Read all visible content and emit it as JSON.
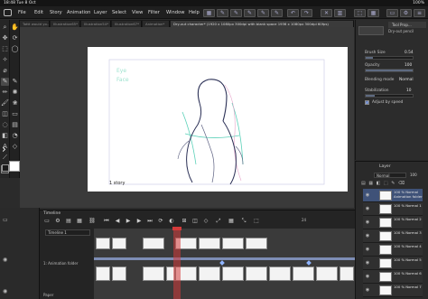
{
  "status_bar": {
    "time": "18:48",
    "date": "Tue 8 Oct",
    "battery": "100%"
  },
  "menubar": {
    "items": [
      "File",
      "Edit",
      "Story",
      "Animation",
      "Layer",
      "Select",
      "View",
      "Filter",
      "Window",
      "Help"
    ]
  },
  "tabs": [
    "Tattt would yo...",
    "Illustration65*",
    "Illustration54*",
    "Illustration67*",
    "Animation*",
    "Dry-out character* (1920 x 1080px 300dpi with blank space 1936 x 1080px 300dpi 60fps)"
  ],
  "properties": {
    "title": "Tool Prop...",
    "brush_name": "Dry-out pencil",
    "brush_size_label": "Brush Size",
    "brush_size_value": "0.54",
    "brush_size_fill": 0.15,
    "opacity_label": "Opacity",
    "opacity_value": "100",
    "opacity_fill": 1.0,
    "blend_label": "Blending mode",
    "blend_value": "Normal",
    "stabilization_label": "Stabilization",
    "stabilization_value": "10",
    "stabilization_fill": 0.2,
    "adjust_speed_label": "Adjust by speed",
    "adjust_speed_checked": true
  },
  "layers": {
    "title": "Layer",
    "blend_mode": "Normal",
    "opacity": "100",
    "active_layer_name": "100 % Normal Animation folder",
    "rows": [
      {
        "label": "100 % Normal Animation folder",
        "active": true
      },
      {
        "label": "100 % Normal 1",
        "active": false
      },
      {
        "label": "100 % Normal 2",
        "active": false
      },
      {
        "label": "100 % Normal 3",
        "active": false
      },
      {
        "label": "100 % Normal 4",
        "active": false
      },
      {
        "label": "100 % Normal 5",
        "active": false
      },
      {
        "label": "100 % Normal 6",
        "active": false
      },
      {
        "label": "100 % Normal 7",
        "active": false
      }
    ]
  },
  "canvas": {
    "caption": "1 story",
    "sketch_stroke_color": "#2a2f55",
    "guide_color": "#5cd1b9",
    "overlay_text_1": "Eye",
    "overlay_text_2": "Face"
  },
  "timeline": {
    "title": "Timeline",
    "timeline_name": "Timeline 1",
    "track_1_label": "1: Animation folder",
    "track_2_label": "Paper",
    "frame_count_label": "24",
    "playhead_color": "#d33b3b"
  },
  "colors": {
    "accent": "#3f5278",
    "keyframe": "#8fb4ff",
    "main_color": "#ffffff",
    "sub_color": "#1a1a1a"
  }
}
